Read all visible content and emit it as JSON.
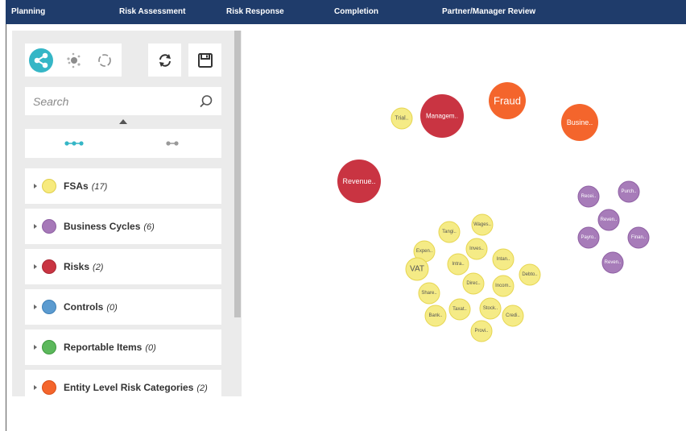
{
  "nav": {
    "tabs": [
      "Planning",
      "Risk Assessment",
      "Risk Response",
      "Completion",
      "Partner/Manager Review"
    ]
  },
  "toolbar": {
    "view_icons": [
      "network-view-icon",
      "cluster-view-icon",
      "circle-view-icon"
    ],
    "action_icons": [
      "refresh-icon",
      "save-icon"
    ],
    "accent_color": "#35b6c6"
  },
  "search": {
    "placeholder": "Search",
    "value": ""
  },
  "layout_options": [
    "expanded-links-icon",
    "collapsed-links-icon"
  ],
  "legend": [
    {
      "label": "FSAs",
      "count": "(17)",
      "color": "#f7ea7d"
    },
    {
      "label": "Business Cycles",
      "count": "(6)",
      "color": "#a678b8"
    },
    {
      "label": "Risks",
      "count": "(2)",
      "color": "#c93442"
    },
    {
      "label": "Controls",
      "count": "(0)",
      "color": "#5b9bd0"
    },
    {
      "label": "Reportable Items",
      "count": "(0)",
      "color": "#5cb85c"
    },
    {
      "label": "Entity Level Risk Categories",
      "count": "(2)",
      "color": "#f4652c"
    }
  ],
  "graph": {
    "colors": {
      "fsa": "#f5eb86",
      "fsa_stroke": "#e6d54f",
      "cycle": "#a77cb9",
      "cycle_stroke": "#8e5fa3",
      "risk": "#c93442",
      "entity": "#f4652c"
    },
    "nodes": [
      {
        "label": "Fraud",
        "type": "entity"
      },
      {
        "label": "Busine..",
        "type": "entity"
      },
      {
        "label": "Managem..",
        "type": "risk"
      },
      {
        "label": "Revenue..",
        "type": "risk"
      },
      {
        "label": "Trial..",
        "type": "fsa"
      },
      {
        "label": "Wages..",
        "type": "fsa"
      },
      {
        "label": "Tangi..",
        "type": "fsa"
      },
      {
        "label": "Inves..",
        "type": "fsa"
      },
      {
        "label": "Expen..",
        "type": "fsa"
      },
      {
        "label": "Intan..",
        "type": "fsa"
      },
      {
        "label": "Intra..",
        "type": "fsa"
      },
      {
        "label": "VAT",
        "type": "fsa"
      },
      {
        "label": "Debto..",
        "type": "fsa"
      },
      {
        "label": "Direc..",
        "type": "fsa"
      },
      {
        "label": "Incom..",
        "type": "fsa"
      },
      {
        "label": "Share..",
        "type": "fsa"
      },
      {
        "label": "Taxat..",
        "type": "fsa"
      },
      {
        "label": "Stock..",
        "type": "fsa"
      },
      {
        "label": "Bank..",
        "type": "fsa"
      },
      {
        "label": "Credi..",
        "type": "fsa"
      },
      {
        "label": "Provi..",
        "type": "fsa"
      },
      {
        "label": "Recei..",
        "type": "cycle"
      },
      {
        "label": "Purch..",
        "type": "cycle"
      },
      {
        "label": "Reven..",
        "type": "cycle"
      },
      {
        "label": "Payro..",
        "type": "cycle"
      },
      {
        "label": "Finan..",
        "type": "cycle"
      },
      {
        "label": "Reven..",
        "type": "cycle"
      }
    ]
  }
}
